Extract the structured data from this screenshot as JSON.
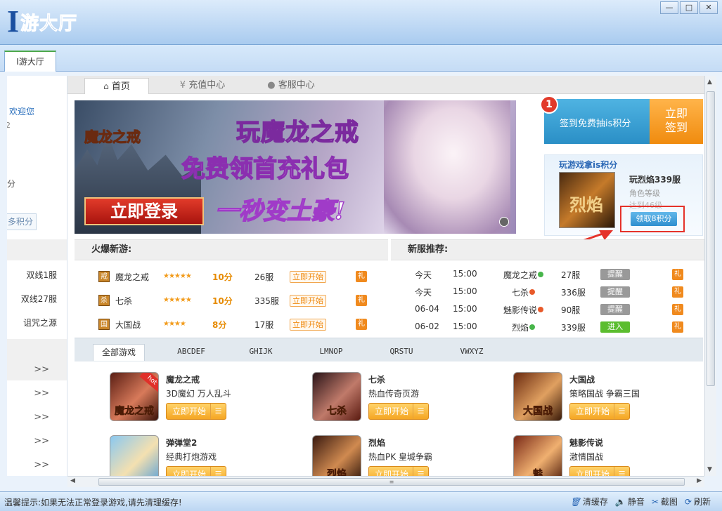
{
  "app": {
    "logo_i": "I",
    "logo_text": "游大厅"
  },
  "window_buttons": [
    "—",
    "□",
    "✕"
  ],
  "main_tab": "I游大厅",
  "left": {
    "welcome": "欢迎您",
    "level_frag": "2",
    "points_frag": "分",
    "points_btn": "多积分",
    "servers": [
      "双线1服",
      "双线27服",
      "诅咒之源"
    ],
    "arrows": [
      ">>",
      ">>",
      ">>",
      ">>",
      ">>"
    ]
  },
  "nav": {
    "home": "首页",
    "recharge": "充值中心",
    "service": "客服中心"
  },
  "banner": {
    "logo": "魔龙之戒",
    "line1": "玩魔龙之戒",
    "line2": "免费领首充礼包",
    "line3": "一秒变土豪!",
    "login_btn": "立即登录"
  },
  "checkin": {
    "badge": "1",
    "text": "签到免费抽is积分",
    "button_l1": "立即",
    "button_l2": "签到"
  },
  "game_points": {
    "title": "玩游戏拿is积分",
    "thumb_text": "烈焰",
    "name": "玩烈焰339服",
    "desc1": "角色等级",
    "desc2": "达到46级",
    "claim": "领取8积分"
  },
  "hot": {
    "title": "火爆新游:",
    "rows": [
      {
        "icon": "戒",
        "name": "魔龙之戒",
        "stars": "★★★★★",
        "score": "10分",
        "servers": "26服",
        "start": "立即开始",
        "gift": "礼"
      },
      {
        "icon": "杀",
        "name": "七杀",
        "stars": "★★★★★",
        "score": "10分",
        "servers": "335服",
        "start": "立即开始",
        "gift": "礼"
      },
      {
        "icon": "国",
        "name": "大国战",
        "stars": "★★★★",
        "score": "8分",
        "servers": "17服",
        "start": "立即开始",
        "gift": "礼"
      }
    ]
  },
  "new_servers": {
    "title": "新服推荐:",
    "rows": [
      {
        "date": "今天",
        "time": "15:00",
        "game": "魔龙之戒",
        "server": "27服",
        "action": "提醒",
        "gift": "礼"
      },
      {
        "date": "今天",
        "time": "15:00",
        "game": "七杀",
        "server": "336服",
        "action": "提醒",
        "gift": "礼"
      },
      {
        "date": "06-04",
        "time": "15:00",
        "game": "魅影传说",
        "server": "90服",
        "action": "提醒",
        "gift": "礼"
      },
      {
        "date": "06-02",
        "time": "15:00",
        "game": "烈焰",
        "server": "339服",
        "action": "进入",
        "gift": "礼"
      }
    ]
  },
  "filters": [
    "全部游戏",
    "ABCDEF",
    "GHIJK",
    "LMNOP",
    "QRSTU",
    "VWXYZ"
  ],
  "games": [
    {
      "name": "魔龙之戒",
      "desc": "3D魔幻 万人乱斗",
      "play": "立即开始",
      "menu": "☰",
      "thumb": "魔龙之戒",
      "hot": "hot"
    },
    {
      "name": "七杀",
      "desc": "热血传奇页游",
      "play": "立即开始",
      "menu": "☰",
      "thumb": "七杀"
    },
    {
      "name": "大国战",
      "desc": "策略国战 争霸三国",
      "play": "立即开始",
      "menu": "☰",
      "thumb": "大国战"
    },
    {
      "name": "弹弹堂2",
      "desc": "经典打炮游戏",
      "play": "立即开始",
      "menu": "☰",
      "thumb": ""
    },
    {
      "name": "烈焰",
      "desc": "热血PK 皇城争霸",
      "play": "立即开始",
      "menu": "☰",
      "thumb": "烈焰"
    },
    {
      "name": "魅影传说",
      "desc": "激情国战",
      "play": "立即开始",
      "menu": "☰",
      "thumb": "魅"
    }
  ],
  "status": {
    "tip": "温馨提示:如果无法正常登录游戏,请先清理缓存!",
    "clear": "清缓存",
    "mute": "静音",
    "screenshot": "截图",
    "refresh": "刷新"
  }
}
